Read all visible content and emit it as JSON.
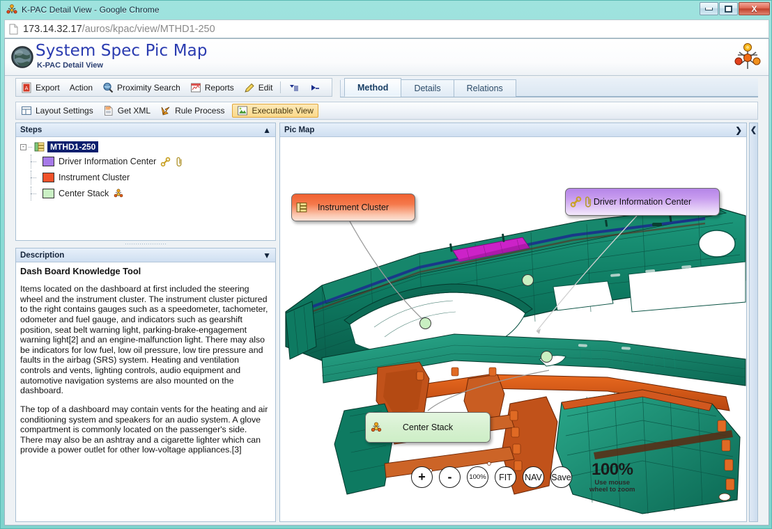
{
  "window": {
    "title": "K-PAC Detail View - Google Chrome",
    "title_icon": "kpac-molecule-icon",
    "minimize_label": "",
    "maximize_label": "",
    "close_label": "X"
  },
  "address_bar": {
    "icon": "page-icon",
    "url_host": "173.14.32.17",
    "url_path": "/auros/kpac/view/MTHD1-250"
  },
  "header": {
    "icon": "globe-icon",
    "title": "System Spec Pic Map",
    "subtitle": "K-PAC Detail View",
    "brand_logo": "molecule-brand-logo"
  },
  "toolbar_primary": {
    "items": [
      {
        "label": "Export",
        "icon": "pdf-export-icon"
      },
      {
        "label": "Action",
        "icon": ""
      },
      {
        "label": "Proximity Search",
        "icon": "magnifier-globe-icon"
      },
      {
        "label": "Reports",
        "icon": "reports-chart-icon"
      },
      {
        "label": "Edit",
        "icon": "pencil-icon"
      }
    ],
    "extra_icons": [
      {
        "name": "dropdown-list-icon"
      },
      {
        "name": "play-step-icon"
      }
    ]
  },
  "tabs": [
    {
      "label": "Method",
      "active": true
    },
    {
      "label": "Details",
      "active": false
    },
    {
      "label": "Relations",
      "active": false
    }
  ],
  "toolbar_secondary": {
    "items": [
      {
        "label": "Layout Settings",
        "icon": "layout-settings-icon"
      },
      {
        "label": "Get XML",
        "icon": "xml-document-icon"
      },
      {
        "label": "Rule Process",
        "icon": "rule-process-icon"
      }
    ],
    "highlighted": {
      "label": "Executable View",
      "icon": "executable-view-icon"
    },
    "highlight_color": "#fbd98a",
    "highlight_border": "#e0a63a"
  },
  "steps_panel": {
    "title": "Steps",
    "collapse_chevron": "chevron-up-icon",
    "root": {
      "label": "MTHD1-250",
      "expander": "-",
      "icon": "method-stack-icon"
    },
    "children": [
      {
        "label": "Driver Information Center",
        "color": "#a679e8",
        "icons": [
          "link-icon",
          "paperclip-icon"
        ]
      },
      {
        "label": "Instrument Cluster",
        "color": "#f0522a",
        "icons": []
      },
      {
        "label": "Center Stack",
        "color": "#caf0c4",
        "icons": [
          "molecule-icon"
        ]
      }
    ]
  },
  "description_panel": {
    "title": "Description",
    "collapse_chevron": "chevron-down-icon",
    "heading": "Dash Board Knowledge Tool",
    "paragraph_1": "Items located on the dashboard at first included the steering wheel and the instrument cluster. The instrument cluster pictured to the right contains gauges such as a speedometer, tachometer, odometer and fuel gauge, and indicators such as gearshift position, seat belt warning light, parking-brake-engagement warning light[2] and an engine-malfunction light. There may also be indicators for low fuel, low oil pressure, low tire pressure and faults in the airbag (SRS) system. Heating and ventilation controls and vents, lighting controls, audio equipment and automotive navigation systems are also mounted on the dashboard.",
    "paragraph_2": "The top of a dashboard may contain vents for the heating and air conditioning system and speakers for an audio system. A glove compartment is commonly located on the passenger's side. There may also be an ashtray and a cigarette lighter which can provide a power outlet for other low-voltage appliances.[3]"
  },
  "picmap_panel": {
    "title": "Pic Map",
    "expand_chevron": "chevron-right-icon",
    "collapse_rail_chevron": "chevron-left-icon",
    "callouts": [
      {
        "label": "Instrument Cluster",
        "color": "#f06030",
        "icons": [
          "method-stack-icon"
        ]
      },
      {
        "label": "Driver Information Center",
        "color": "#b585e8",
        "icons": [
          "link-icon",
          "paperclip-icon"
        ]
      },
      {
        "label": "Center Stack",
        "color": "#d8f1d2",
        "icons": [
          "molecule-icon"
        ]
      }
    ],
    "hotspot_color": "#c9f0c2",
    "model_colors": {
      "body": "#0f7a63",
      "accent": "#d1581f",
      "highlight": "#cc22c8",
      "trim": "#1a237e"
    }
  },
  "zoom_controls": {
    "buttons": [
      {
        "label": "+",
        "name": "zoom-in-button"
      },
      {
        "label": "-",
        "name": "zoom-out-button"
      },
      {
        "label": "100%",
        "name": "zoom-reset-button"
      },
      {
        "label": "FIT",
        "name": "zoom-fit-button"
      },
      {
        "label": "NAV",
        "name": "navigate-button"
      },
      {
        "label": "Save",
        "name": "save-view-button"
      }
    ],
    "level": "100%",
    "hint_line_1": "Use mouse",
    "hint_line_2": "wheel to zoom"
  }
}
